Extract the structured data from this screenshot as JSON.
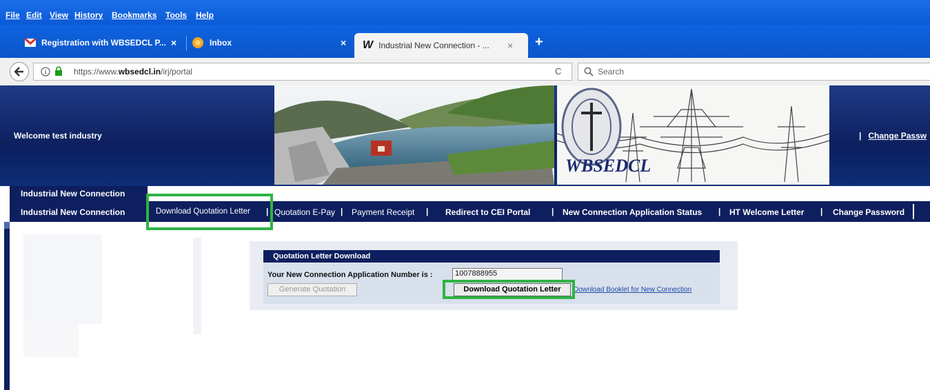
{
  "browser": {
    "menu": [
      "File",
      "Edit",
      "View",
      "History",
      "Bookmarks",
      "Tools",
      "Help"
    ],
    "tabs": [
      {
        "title": "Registration with WBSEDCL P..."
      },
      {
        "title": "Inbox"
      },
      {
        "title": "Industrial New Connection - ..."
      }
    ],
    "new_tab_symbol": "+",
    "close_symbol": "×",
    "url_prefix": "https://www.",
    "url_domain": "wbsedcl.in",
    "url_path": "/irj/portal",
    "reload_symbol": "C",
    "search_placeholder": "Search"
  },
  "header": {
    "welcome": "Welcome test industry",
    "logo_text": "WBSEDCL",
    "change_password_sep": "|",
    "change_password": "Change Passw"
  },
  "nav": {
    "top_label": "Industrial New Connection",
    "items": [
      "Industrial New Connection",
      "Download Quotation Letter",
      "Quotation E-Pay",
      "Payment Receipt",
      "Redirect to CEI Portal",
      "New Connection Application Status",
      "HT Welcome Letter",
      "Change Password"
    ],
    "separator": "|"
  },
  "quotation": {
    "panel_title": "Quotation Letter Download",
    "app_number_label": "Your New Connection Application Number is :",
    "app_number": "1007888955",
    "generate_button": "Generate Quotation",
    "download_button": "Download Quotation Letter",
    "booklet_link": "Download Booklet for New Connection"
  },
  "colors": {
    "browser_blue": "#0b5ad6",
    "portal_navy": "#0d1f5e",
    "highlight_green": "#2fb344"
  }
}
